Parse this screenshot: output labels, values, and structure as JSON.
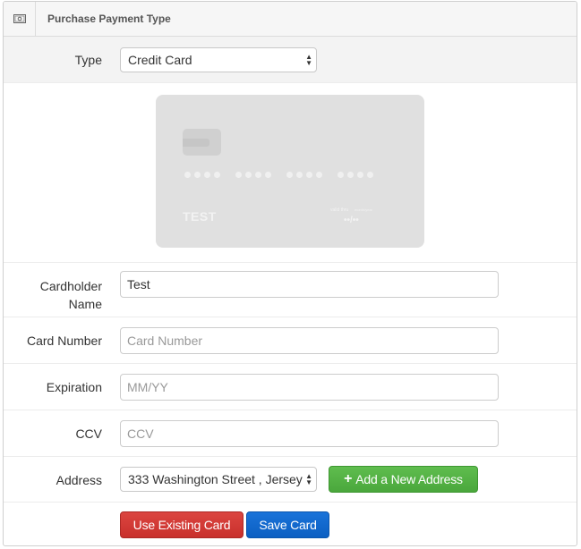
{
  "panel": {
    "title": "Purchase Payment Type",
    "icon": "money-icon"
  },
  "type_field": {
    "label": "Type",
    "selected": "Credit Card"
  },
  "card_preview": {
    "name": "TEST",
    "number_mask": "•••• •••• •••• ••••",
    "expiry_mask": "••/••",
    "valid_label": "valid thru",
    "month_year_label": "month/year"
  },
  "form": {
    "cardholder_label": "Cardholder Name",
    "cardholder_value": "Test",
    "card_number_label": "Card Number",
    "card_number_placeholder": "Card Number",
    "expiration_label": "Expiration",
    "expiration_placeholder": "MM/YY",
    "ccv_label": "CCV",
    "ccv_placeholder": "CCV",
    "address_label": "Address",
    "address_selected": "333 Washington Street , Jersey"
  },
  "buttons": {
    "add_address": "Add a New Address",
    "add_address_icon": "plus-icon",
    "use_existing": "Use Existing Card",
    "save_card": "Save Card"
  },
  "colors": {
    "green": "#4cae3f",
    "red": "#d2322d",
    "blue": "#0d66cc"
  }
}
